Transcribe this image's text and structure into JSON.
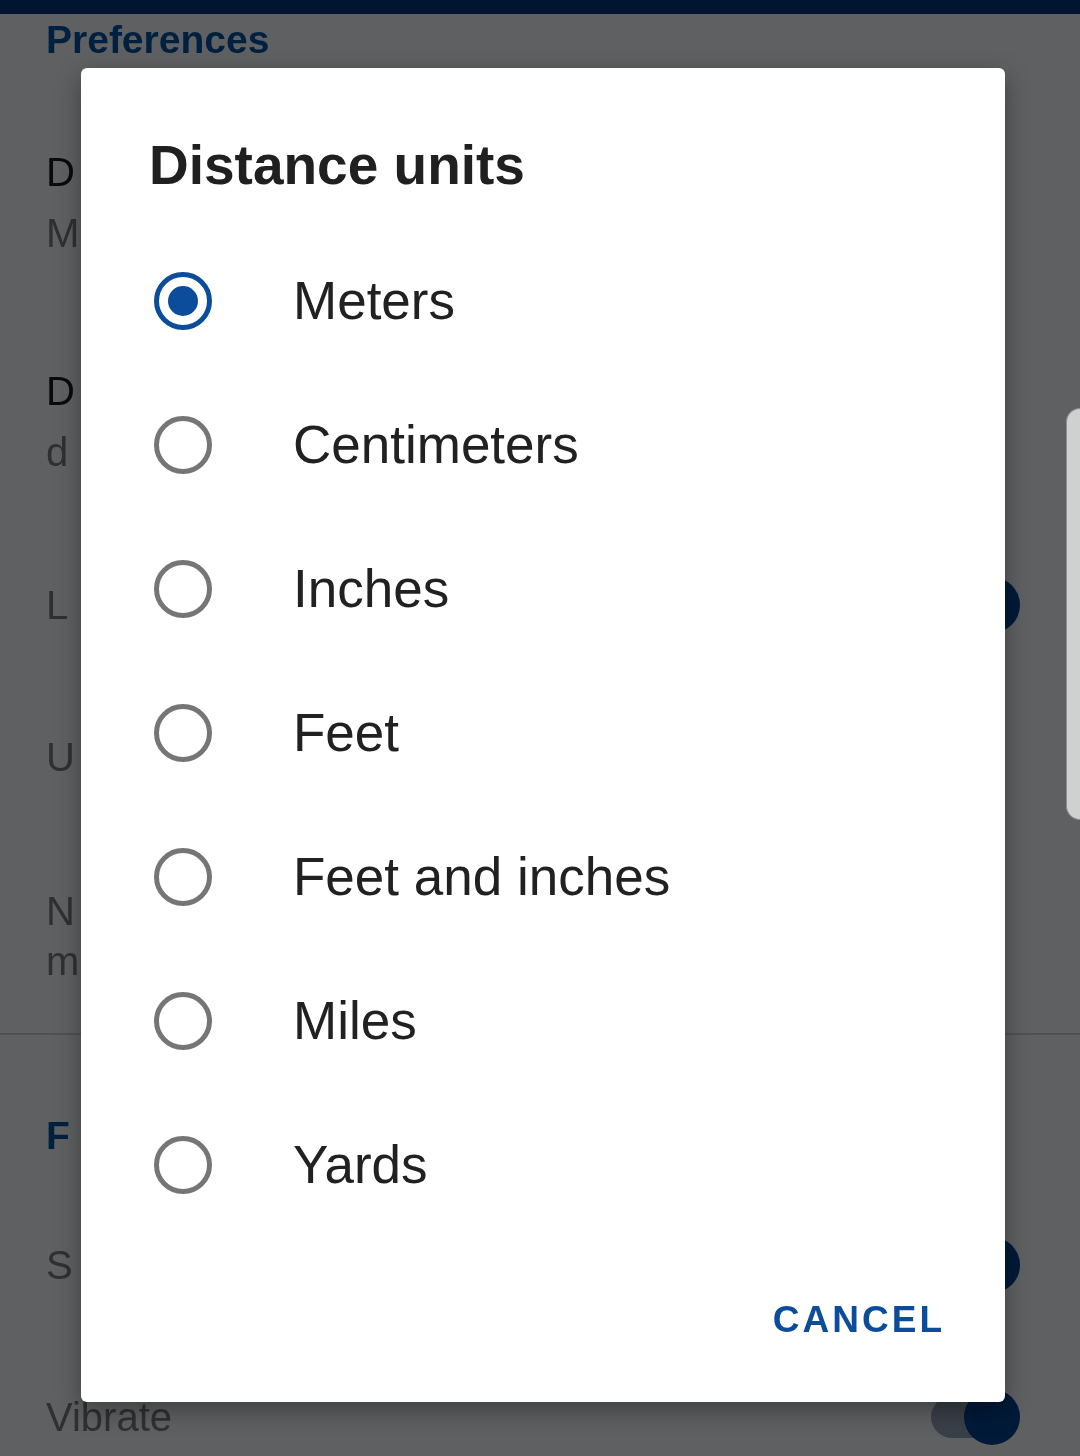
{
  "settings": {
    "sections": [
      {
        "header": "Preferences",
        "items": [
          {
            "kind": "choice",
            "title": "D",
            "summary": "M"
          },
          {
            "kind": "choice",
            "title": "D",
            "summary": "d"
          },
          {
            "kind": "switch",
            "title": "L",
            "on": true
          },
          {
            "kind": "text",
            "title": "U"
          },
          {
            "kind": "text",
            "title": "N",
            "summary": "m"
          }
        ]
      },
      {
        "header": "F",
        "items": [
          {
            "kind": "switch",
            "title": "S",
            "on": true
          },
          {
            "kind": "switch",
            "title": "Vibrate",
            "on": true
          }
        ]
      }
    ]
  },
  "dialog": {
    "title": "Distance units",
    "options": [
      {
        "label": "Meters",
        "selected": true
      },
      {
        "label": "Centimeters",
        "selected": false
      },
      {
        "label": "Inches",
        "selected": false
      },
      {
        "label": "Feet",
        "selected": false
      },
      {
        "label": "Feet and inches",
        "selected": false
      },
      {
        "label": "Miles",
        "selected": false
      },
      {
        "label": "Yards",
        "selected": false
      }
    ],
    "buttons": [
      {
        "label": "CANCEL"
      }
    ]
  }
}
